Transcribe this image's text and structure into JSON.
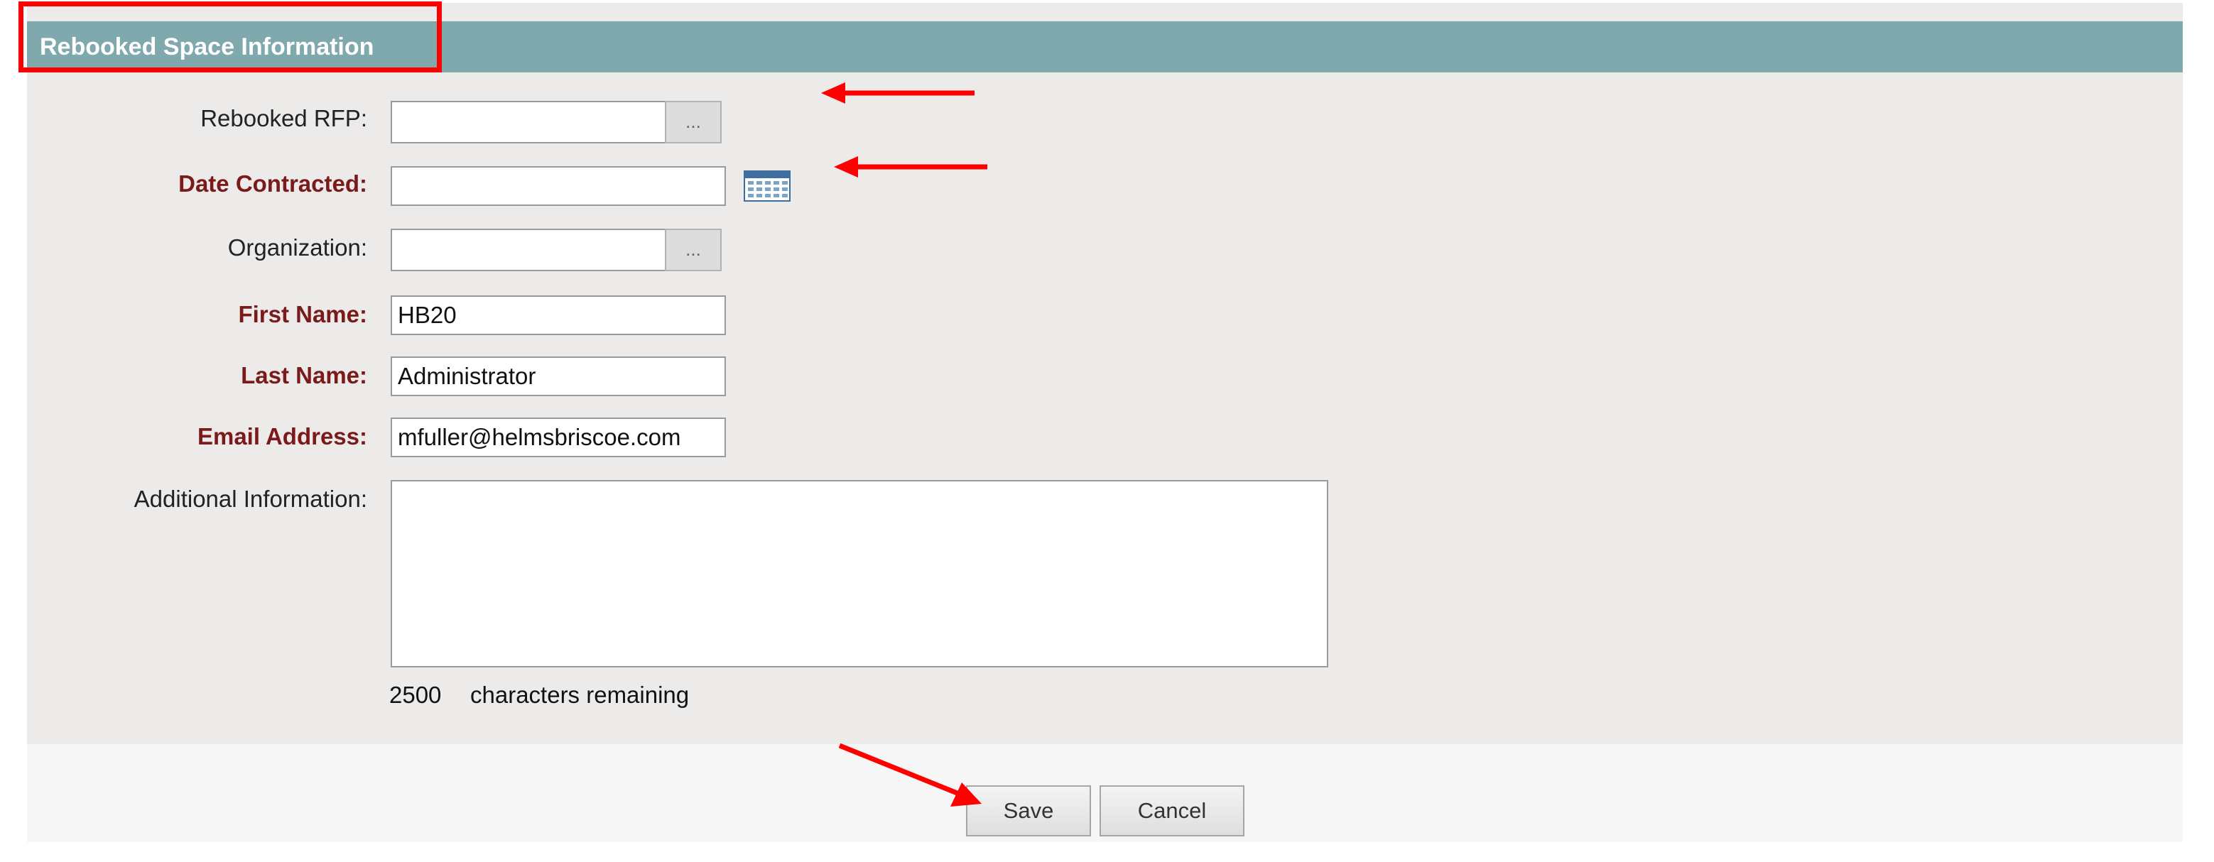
{
  "section": {
    "title": "Rebooked Space Information"
  },
  "form": {
    "rebooked_rfp": {
      "label": "Rebooked RFP:",
      "value": "",
      "lookup_label": "..."
    },
    "date_contracted": {
      "label": "Date Contracted:",
      "value": ""
    },
    "organization": {
      "label": "Organization:",
      "value": "",
      "lookup_label": "..."
    },
    "first_name": {
      "label": "First Name:",
      "value": "HB20"
    },
    "last_name": {
      "label": "Last Name:",
      "value": "Administrator"
    },
    "email_address": {
      "label": "Email Address:",
      "value": "mfuller@helmsbriscoe.com"
    },
    "additional_information": {
      "label": "Additional Information:",
      "value": ""
    },
    "characters_remaining": {
      "count": "2500",
      "text": "characters remaining"
    }
  },
  "actions": {
    "save_label": "Save",
    "cancel_label": "Cancel"
  },
  "annotation": {
    "color": "#ff0000"
  },
  "colors": {
    "header_bar": "#7fa9ad",
    "required_label": "#7a1a1a",
    "panel_background": "#ecebea"
  },
  "icons": {
    "calendar": "calendar-icon",
    "lookup": "ellipsis"
  }
}
